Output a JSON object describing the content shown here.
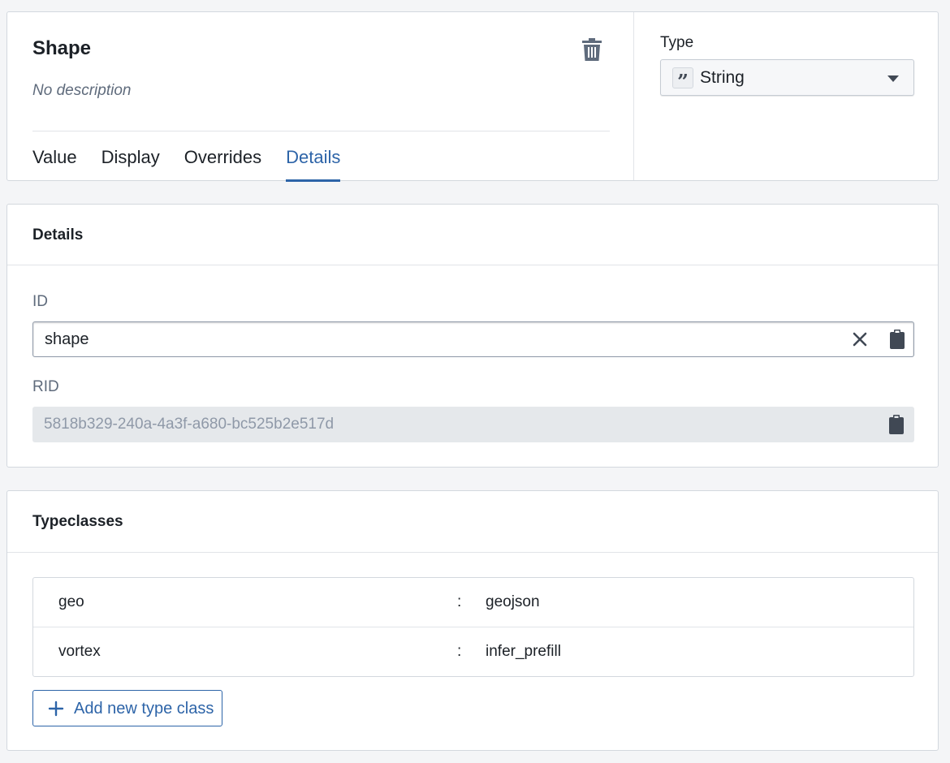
{
  "header": {
    "title": "Shape",
    "description": "No description",
    "tabs": [
      {
        "label": "Value",
        "active": false
      },
      {
        "label": "Display",
        "active": false
      },
      {
        "label": "Overrides",
        "active": false
      },
      {
        "label": "Details",
        "active": true
      }
    ],
    "type_label": "Type",
    "type_value": "String",
    "type_icon": "quote-icon"
  },
  "details": {
    "title": "Details",
    "id_label": "ID",
    "id_value": "shape",
    "rid_label": "RID",
    "rid_value": "5818b329-240a-4a3f-a680-bc525b2e517d"
  },
  "typeclasses": {
    "title": "Typeclasses",
    "rows": [
      {
        "key": "geo",
        "separator": ":",
        "value": "geojson"
      },
      {
        "key": "vortex",
        "separator": ":",
        "value": "infer_prefill"
      }
    ],
    "add_label": "Add new type class"
  },
  "colors": {
    "accent": "#2d64a8",
    "text": "#1c2127",
    "muted": "#5f6b7c",
    "background": "#f4f5f7"
  }
}
